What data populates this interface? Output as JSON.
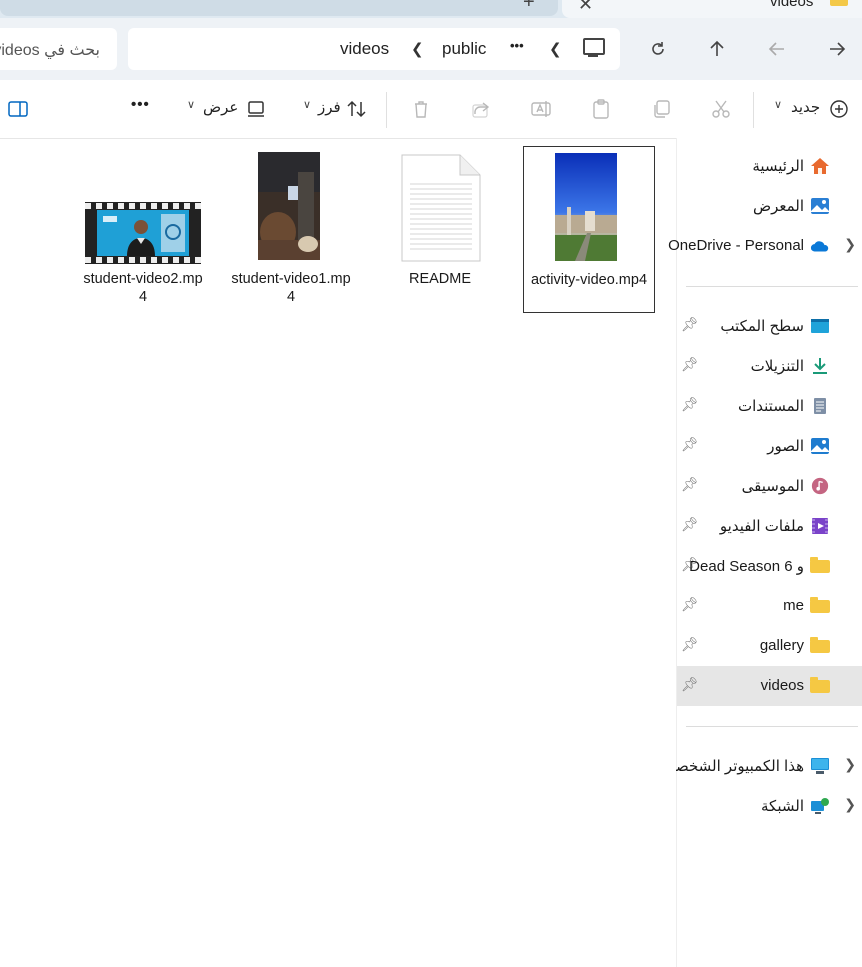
{
  "window": {
    "tab_title": "videos",
    "tab_new_label": "+",
    "tab_close_label": "✕"
  },
  "address_bar": {
    "breadcrumbs": [
      "videos",
      "public"
    ],
    "more_label": "•••",
    "search_placeholder": "بحث في videos"
  },
  "command_bar": {
    "new_label": "جديد",
    "sort_label": "فرز",
    "view_label": "عرض",
    "more_label": "•••"
  },
  "sidebar": {
    "top_items": [
      {
        "label": "الرئيسية",
        "icon": "home-icon"
      },
      {
        "label": "المعرض",
        "icon": "gallery-icon"
      },
      {
        "label": "OneDrive - Personal",
        "icon": "onedrive-cloud-icon",
        "expandable": true
      }
    ],
    "quick_access": [
      {
        "label": "سطح المكتب",
        "icon": "desktop-icon",
        "pinned": true
      },
      {
        "label": "التنزيلات",
        "icon": "downloads-icon",
        "pinned": true
      },
      {
        "label": "المستندات",
        "icon": "documents-icon",
        "pinned": true
      },
      {
        "label": "الصور",
        "icon": "pictures-icon",
        "pinned": true
      },
      {
        "label": "الموسيقى",
        "icon": "music-icon",
        "pinned": true
      },
      {
        "label": "ملفات الفيديو",
        "icon": "videos-library-icon",
        "pinned": true
      },
      {
        "label": "Dead Season 6 و",
        "icon": "folder-icon",
        "pinned": true
      },
      {
        "label": "me",
        "icon": "folder-icon",
        "pinned": true
      },
      {
        "label": "gallery",
        "icon": "folder-icon",
        "pinned": true
      },
      {
        "label": "videos",
        "icon": "folder-icon",
        "pinned": true,
        "selected": true
      }
    ],
    "bottom_items": [
      {
        "label": "هذا الكمبيوتر الشخصي",
        "icon": "this-pc-icon",
        "expandable": true
      },
      {
        "label": "الشبكة",
        "icon": "network-icon",
        "expandable": true
      }
    ]
  },
  "files": [
    {
      "name": "activity-video.mp4",
      "type": "video",
      "selected": true
    },
    {
      "name": "README",
      "type": "document",
      "selected": false
    },
    {
      "name": "student-video1.mp4",
      "type": "video",
      "selected": false
    },
    {
      "name": "student-video2.mp4",
      "type": "video",
      "selected": false
    }
  ],
  "colors": {
    "accent": "#0067c0",
    "folder": "#f5c843",
    "selected_nav": "#e6e6e6",
    "address_bg": "#eef2f6"
  }
}
